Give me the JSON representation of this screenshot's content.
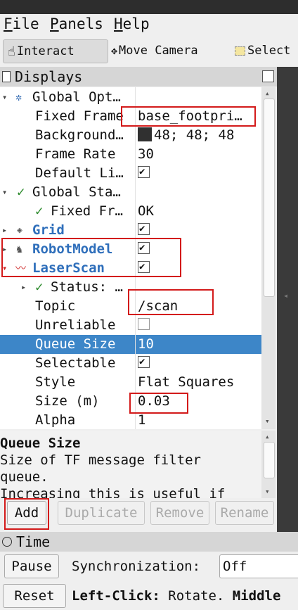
{
  "menu": {
    "file": "File",
    "file_rest": "ile",
    "panels_u": "P",
    "panels_rest": "anels",
    "help_u": "H",
    "help_rest": "elp"
  },
  "toolbar": {
    "interact": "Interact",
    "move_camera": "Move Camera",
    "select": "Select"
  },
  "displays_panel": {
    "title": "Displays"
  },
  "tree": {
    "rows": [
      {
        "name": "Global Opt…",
        "value": ""
      },
      {
        "name": "Fixed Frame",
        "value": "base_footpri…"
      },
      {
        "name": "Background…",
        "value": "48; 48; 48"
      },
      {
        "name": "Frame Rate",
        "value": "30"
      },
      {
        "name": "Default Li…",
        "value": ""
      },
      {
        "name": "Global Sta…",
        "value": ""
      },
      {
        "name": "Fixed Fr…",
        "value": "OK"
      },
      {
        "name": "Grid",
        "value": ""
      },
      {
        "name": "RobotModel",
        "value": ""
      },
      {
        "name": "LaserScan",
        "value": ""
      },
      {
        "name": "Status: …",
        "value": ""
      },
      {
        "name": "Topic",
        "value": "/scan"
      },
      {
        "name": "Unreliable",
        "value": ""
      },
      {
        "name": "Queue Size",
        "value": "10"
      },
      {
        "name": "Selectable",
        "value": ""
      },
      {
        "name": "Style",
        "value": "Flat Squares"
      },
      {
        "name": "Size (m)",
        "value": "0.03"
      },
      {
        "name": "Alpha",
        "value": "1"
      }
    ]
  },
  "help": {
    "title": "Queue Size",
    "line1": "Size of TF message filter",
    "line2": "queue.",
    "line3": "Increasing this is useful if"
  },
  "buttons": {
    "add": "Add",
    "duplicate": "Duplicate",
    "remove": "Remove",
    "rename": "Rename"
  },
  "time_panel": {
    "title": "Time"
  },
  "bottom": {
    "pause": "Pause",
    "sync_label": "Synchronization:",
    "sync_value": "Off",
    "reset": "Reset",
    "hint_bold": "Left-Click:",
    "hint_text": " Rotate. ",
    "hint_bold2": "Middle"
  },
  "colors": {
    "selection": "#3d86c8",
    "annotation": "#d31a1a",
    "display_name": "#2f6fbb",
    "background_swatch": "#303030"
  }
}
